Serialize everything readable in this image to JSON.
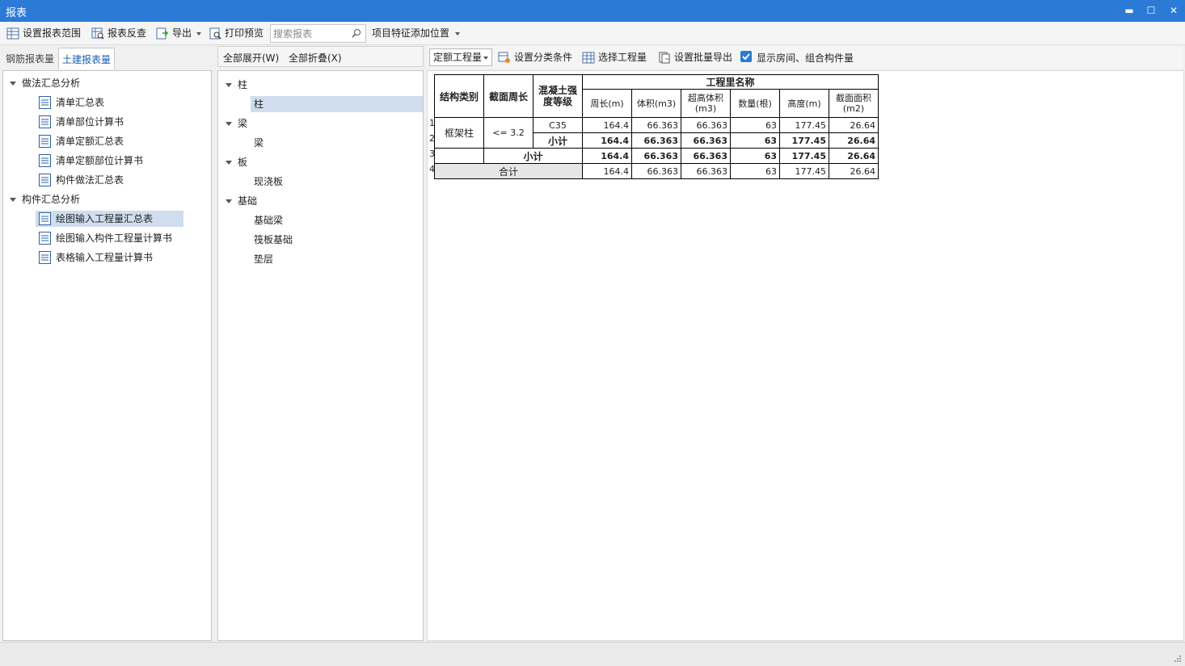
{
  "window": {
    "title": "报表",
    "minimize": "▬",
    "maximize": "☐",
    "close": "✕"
  },
  "toolbar": {
    "set_range": "设置报表范围",
    "reverse_check": "报表反查",
    "export": "导出",
    "print_preview": "打印预览",
    "search_placeholder": "搜索报表",
    "feature_position": "项目特征添加位置"
  },
  "left_tabs": {
    "rebar": "钢筋报表量",
    "civil": "土建报表量",
    "active": "civil"
  },
  "left_tree": [
    {
      "label": "做法汇总分析",
      "children": [
        "清单汇总表",
        "清单部位计算书",
        "清单定额汇总表",
        "清单定额部位计算书",
        "构件做法汇总表"
      ]
    },
    {
      "label": "构件汇总分析",
      "children": [
        "绘图输入工程量汇总表",
        "绘图输入构件工程量计算书",
        "表格输入工程量计算书"
      ],
      "selected_child": 0
    }
  ],
  "middle": {
    "expand_all": "全部展开(W)",
    "collapse_all": "全部折叠(X)",
    "tree": [
      {
        "label": "柱",
        "children": [
          "柱"
        ],
        "selected_child": 0
      },
      {
        "label": "梁",
        "children": [
          "梁"
        ]
      },
      {
        "label": "板",
        "children": [
          "现浇板"
        ]
      },
      {
        "label": "基础",
        "children": [
          "基础梁",
          "筏板基础",
          "垫层"
        ]
      }
    ]
  },
  "right_toolbar": {
    "combo": "定额工程量",
    "set_category": "设置分类条件",
    "select_quantity": "选择工程量",
    "batch_export": "设置批量导出",
    "show_rooms": "显示房间、组合构件量",
    "show_rooms_checked": true
  },
  "table": {
    "headers": {
      "struct_type": "结构类别",
      "perimeter": "截面周长",
      "concrete": "混凝土强度等级",
      "quantity_name": "工程里名称",
      "cols": [
        "周长(m)",
        "体积(m3)",
        "超高体积(m3)",
        "数量(根)",
        "高度(m)",
        "截面面积(m2)"
      ]
    },
    "row_numbers": [
      "1",
      "2",
      "3",
      "4"
    ],
    "struct_value": "框架柱",
    "perimeter_value": "<= 3.2",
    "grade_value": "C35",
    "subtotal": "小计",
    "total": "合计",
    "row1": [
      "164.4",
      "66.363",
      "66.363",
      "63",
      "177.45",
      "26.64"
    ],
    "row2": [
      "164.4",
      "66.363",
      "66.363",
      "63",
      "177.45",
      "26.64"
    ],
    "row3": [
      "164.4",
      "66.363",
      "66.363",
      "63",
      "177.45",
      "26.64"
    ],
    "row4": [
      "164.4",
      "66.363",
      "66.363",
      "63",
      "177.45",
      "26.64"
    ]
  }
}
